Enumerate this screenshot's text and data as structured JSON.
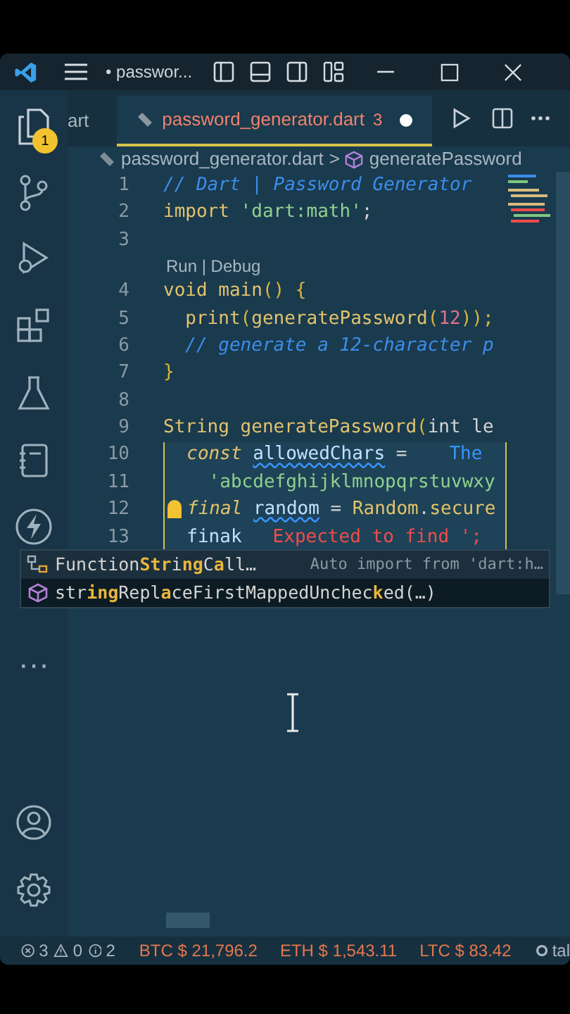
{
  "title_bar": {
    "title": "• passwor..."
  },
  "tabs": [
    {
      "label": "art",
      "selected": false
    },
    {
      "label": "password_generator.dart",
      "problems": "3",
      "modified": true,
      "selected": true
    }
  ],
  "breadcrumb": {
    "file": "password_generator.dart",
    "separator": ">",
    "symbol": "generatePassword"
  },
  "activity_bar": {
    "explorer_badge": "1",
    "more": "···"
  },
  "editor": {
    "lines": [
      {
        "number": "1",
        "boxed": false,
        "tokens": [
          {
            "t": "// Dart | Password Generator",
            "kind": "comment"
          }
        ]
      },
      {
        "number": "2",
        "boxed": false,
        "tokens": [
          {
            "t": "import ",
            "kind": "kw"
          },
          {
            "t": "'dart:math'",
            "kind": "str"
          },
          {
            "t": ";",
            "kind": "plain"
          }
        ]
      },
      {
        "number": "3",
        "boxed": false
      },
      {
        "codelens": "Run | Debug",
        "number": "4",
        "boxed": false,
        "tokens": [
          {
            "t": "void ",
            "kind": "kw"
          },
          {
            "t": "main",
            "kind": "fn"
          },
          {
            "t": "() {",
            "kind": "paren"
          }
        ]
      },
      {
        "number": "5",
        "boxed": false,
        "tokens": [
          {
            "t": "  print",
            "kind": "fn"
          },
          {
            "t": "(",
            "kind": "paren"
          },
          {
            "t": "generatePassword",
            "kind": "fn"
          },
          {
            "t": "(",
            "kind": "paren"
          },
          {
            "t": "12",
            "kind": "num"
          },
          {
            "t": "));",
            "kind": "paren"
          }
        ]
      },
      {
        "number": "6",
        "boxed": false,
        "tokens": [
          {
            "t": "  // generate a 12-character p",
            "kind": "comment"
          }
        ]
      },
      {
        "number": "7",
        "boxed": false,
        "tokens": [
          {
            "t": "}",
            "kind": "paren"
          }
        ]
      },
      {
        "number": "8",
        "boxed": false
      },
      {
        "number": "9",
        "boxed": false,
        "tokens": [
          {
            "t": "String ",
            "kind": "kw"
          },
          {
            "t": "generatePassword",
            "kind": "fn"
          },
          {
            "t": "(",
            "kind": "paren"
          },
          {
            "t": "int le",
            "kind": "plain"
          }
        ]
      },
      {
        "number": "10",
        "boxed": true,
        "tokens": [
          {
            "t": "  const ",
            "kind": "storage"
          },
          {
            "t": "allowedChars",
            "kind": "var_warn"
          },
          {
            "t": " =",
            "kind": "plain"
          },
          {
            "t": "The",
            "kind": "hint"
          }
        ]
      },
      {
        "number": "11",
        "boxed": true,
        "tokens": [
          {
            "t": "    'abcdefghijklmnopqrstuvwxy",
            "kind": "str"
          }
        ]
      },
      {
        "number": "12",
        "boxed": true,
        "lightbulb": true,
        "tokens": [
          {
            "t": "final ",
            "kind": "storage"
          },
          {
            "t": "random",
            "kind": "var_warn"
          },
          {
            "t": " = ",
            "kind": "plain"
          },
          {
            "t": "Random",
            "kind": "fn"
          },
          {
            "t": ".",
            "kind": "plain"
          },
          {
            "t": "secure",
            "kind": "fn"
          }
        ]
      },
      {
        "number": "13",
        "boxed": true,
        "tokens": [
          {
            "t": "  finak",
            "kind": "var"
          },
          {
            "t": "Expected to find ';",
            "kind": "error"
          }
        ]
      }
    ]
  },
  "suggestions": [
    {
      "kind": "class",
      "label": "Function**Str**i**ng**C**a**ll…",
      "detail": "Auto import from 'dart:h…",
      "selected": false
    },
    {
      "kind": "method",
      "label": "str**ing**Repl**a**ceFirstMappedUnchec**k**ed(…)",
      "selected": true
    }
  ],
  "status_bar": {
    "errors": "3",
    "warnings": "0",
    "infos": "2",
    "tickers": [
      "BTC $ 21,796.2",
      "ETH $ 1,543.11",
      "LTC $ 83.42"
    ],
    "extra": "tal"
  }
}
